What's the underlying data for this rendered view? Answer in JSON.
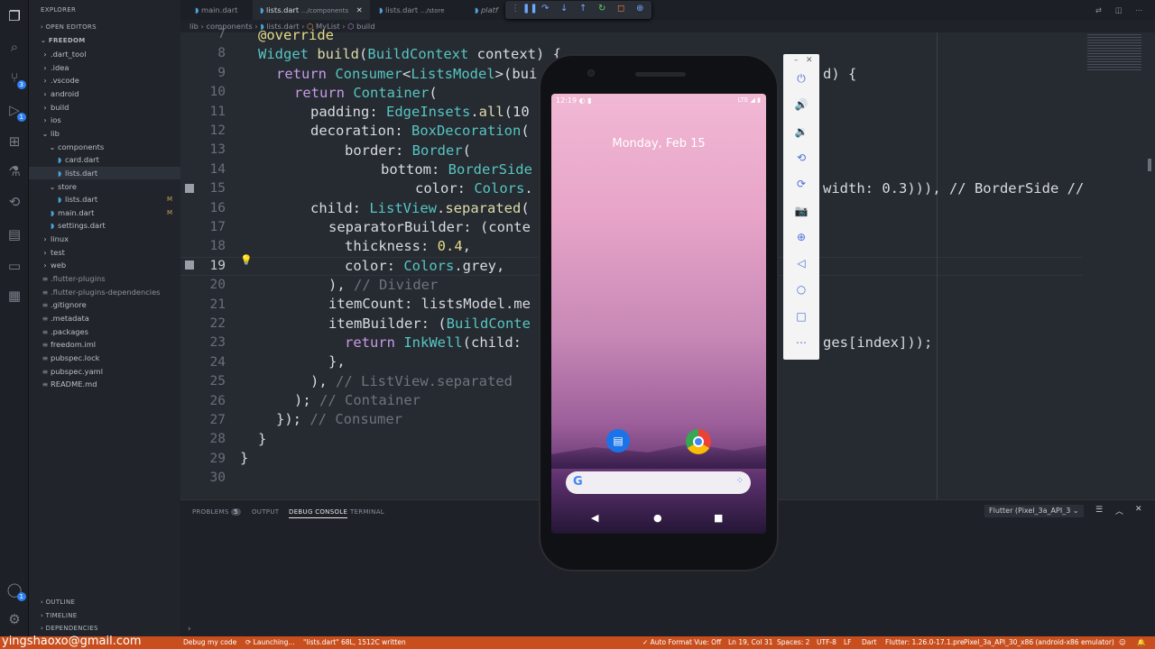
{
  "sidebar": {
    "title": "EXPLORER",
    "open_editors": "OPEN EDITORS",
    "project": "FREEDOM",
    "items": [
      {
        "label": ".dart_tool",
        "type": "folder",
        "indent": 0
      },
      {
        "label": ".idea",
        "type": "folder",
        "indent": 0
      },
      {
        "label": ".vscode",
        "type": "folder",
        "indent": 0
      },
      {
        "label": "android",
        "type": "folder",
        "indent": 0
      },
      {
        "label": "build",
        "type": "folder",
        "indent": 0
      },
      {
        "label": "ios",
        "type": "folder",
        "indent": 0
      },
      {
        "label": "lib",
        "type": "folder-open",
        "indent": 0
      },
      {
        "label": "components",
        "type": "folder-open",
        "indent": 1
      },
      {
        "label": "card.dart",
        "type": "dart",
        "indent": 2
      },
      {
        "label": "lists.dart",
        "type": "dart",
        "indent": 2
      },
      {
        "label": "store",
        "type": "folder-open",
        "indent": 1
      },
      {
        "label": "lists.dart",
        "type": "dart",
        "indent": 2,
        "mark": "M"
      },
      {
        "label": "main.dart",
        "type": "dart",
        "indent": 1,
        "mark": "M"
      },
      {
        "label": "settings.dart",
        "type": "dart",
        "indent": 1
      },
      {
        "label": "linux",
        "type": "folder",
        "indent": 0
      },
      {
        "label": "test",
        "type": "folder",
        "indent": 0
      },
      {
        "label": "web",
        "type": "folder",
        "indent": 0
      },
      {
        "label": ".flutter-plugins",
        "type": "file",
        "indent": 0
      },
      {
        "label": ".flutter-plugins-dependencies",
        "type": "file",
        "indent": 0
      },
      {
        "label": ".gitignore",
        "type": "file",
        "indent": 0
      },
      {
        "label": ".metadata",
        "type": "file",
        "indent": 0
      },
      {
        "label": ".packages",
        "type": "file",
        "indent": 0
      },
      {
        "label": "freedom.iml",
        "type": "file",
        "indent": 0
      },
      {
        "label": "pubspec.lock",
        "type": "file",
        "indent": 0
      },
      {
        "label": "pubspec.yaml",
        "type": "file",
        "indent": 0
      },
      {
        "label": "README.md",
        "type": "file",
        "indent": 0
      }
    ],
    "outline": "OUTLINE",
    "timeline": "TIMELINE",
    "dependencies": "DEPENDENCIES"
  },
  "tabs": [
    {
      "label": "main.dart"
    },
    {
      "label": "lists.dart",
      "path": ".../components",
      "active": true
    },
    {
      "label": "lists.dart",
      "path": ".../store"
    },
    {
      "label": "platf"
    }
  ],
  "breadcrumb": [
    "lib",
    "components",
    "lists.dart",
    "MyList",
    "build"
  ],
  "code_lines": [
    7,
    8,
    9,
    10,
    11,
    12,
    13,
    14,
    15,
    16,
    17,
    18,
    19,
    20,
    21,
    22,
    23,
    24,
    25,
    26,
    27,
    28,
    29,
    30
  ],
  "code_right": [
    "d) {",
    "width: 0.3))), // BorderSide //",
    "ges[index]));"
  ],
  "panel": {
    "problems": "PROBLEMS",
    "problems_count": "5",
    "output": "OUTPUT",
    "debug_console": "DEBUG CONSOLE",
    "terminal": "TERMINAL",
    "target": "Flutter (Pixel_3a_API_3"
  },
  "status": {
    "left_text": "yingshaoxo@gmail.com",
    "debug": "Debug my code",
    "launching": "Launching...",
    "written": "\"lists.dart\" 68L, 1512C written",
    "format": "Auto Format Vue: Off",
    "position": "Ln 19, Col 31",
    "spaces": "Spaces: 2",
    "encoding": "UTF-8",
    "eol": "LF",
    "language": "Dart",
    "flutter": "Flutter: 1.26.0-17.1.pre",
    "device": "Pixel_3a_API_30_x86 (android-x86 emulator)"
  },
  "phone": {
    "time": "12:19",
    "network": "LTE",
    "date": "Monday, Feb 15"
  },
  "emulator_buttons": [
    "power-icon",
    "volume-up-icon",
    "volume-down-icon",
    "rotate-left-icon",
    "rotate-right-icon",
    "camera-icon",
    "zoom-icon",
    "back-icon",
    "home-icon",
    "overview-icon",
    "more-icon"
  ],
  "colors": {
    "statusbar": "#c84f1d",
    "editor_bg": "#262a31",
    "sidebar_bg": "#21252b"
  }
}
